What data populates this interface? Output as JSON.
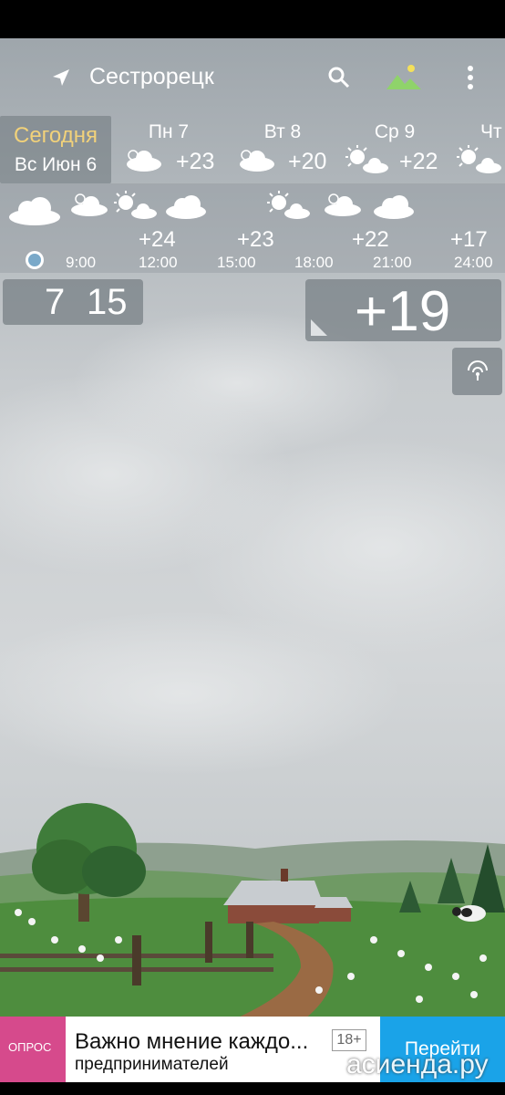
{
  "header": {
    "city": "Сестрорецк",
    "location_icon": "location-arrow-icon",
    "search_icon": "search-icon",
    "background_icon": "landscape-icon",
    "menu_icon": "more-vertical-icon"
  },
  "daily": {
    "today_label": "Сегодня",
    "today_date": "Вс Июн 6",
    "days": [
      {
        "label": "Пн 7",
        "temp": "+23",
        "icon": "cloud-icon"
      },
      {
        "label": "Вт 8",
        "temp": "+20",
        "icon": "cloud-icon"
      },
      {
        "label": "Ср 9",
        "temp": "+22",
        "icon": "partly-sunny-icon"
      },
      {
        "label": "Чт",
        "icon": "partly-sunny-icon"
      }
    ]
  },
  "hourly": {
    "times": [
      "9:00",
      "12:00",
      "15:00",
      "18:00",
      "21:00",
      "24:00"
    ],
    "temps": [
      "+24",
      "+23",
      "+22",
      "+17"
    ]
  },
  "clock": {
    "hours": "7",
    "minutes": "15"
  },
  "current": {
    "temp": "+19"
  },
  "ad": {
    "badge": "ОПРОС",
    "title": "Важно мнение каждо...",
    "subtitle": "предпринимателей",
    "age": "18+",
    "cta": "Перейти"
  },
  "watermark": "асиенда.ру",
  "colors": {
    "accent_today": "#f2d27a",
    "ad_button": "#1aa3e8",
    "ad_badge": "#d64a8c"
  }
}
